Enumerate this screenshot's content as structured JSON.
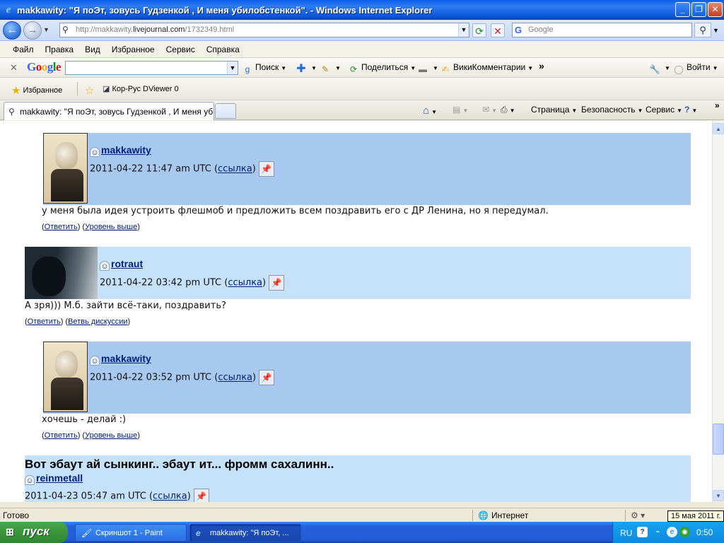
{
  "window": {
    "title": "makkawity: \"Я поЭт, зовусь Гудзенкой , И меня убилобстенкой\". - Windows Internet Explorer"
  },
  "address": {
    "url_prefix": "http://makkawity.",
    "url_domain": "livejournal.com",
    "url_path": "/1732349.html",
    "search_placeholder": "Google"
  },
  "menu": [
    "Файл",
    "Правка",
    "Вид",
    "Избранное",
    "Сервис",
    "Справка"
  ],
  "google_toolbar": {
    "search_label": "Поиск",
    "share_label": "Поделиться",
    "wiki_label": "ВикиКомментарии",
    "login_label": "Войти"
  },
  "favorites": {
    "label": "Избранное",
    "item": "Кор-Рус DViewer 0"
  },
  "tab": {
    "title": "makkawity: \"Я поЭт, зовусь Гудзенкой , И меня уби..."
  },
  "commands": {
    "page": "Страница",
    "security": "Безопасность",
    "service": "Сервис"
  },
  "comments": [
    {
      "user": "makkawity",
      "date": "2011-04-22 11:47 am UTC",
      "link": "ссылка",
      "text": "у меня была идея устроить флешмоб и предложить всем поздравить его с ДР Ленина, но я передумал.",
      "reply": "Ответить",
      "nav": "Уровень выше"
    },
    {
      "user": "rotraut",
      "date": "2011-04-22 03:42 pm UTC",
      "link": "ссылка",
      "text": "А зря))) М.б. зайти всё-таки, поздравить?",
      "reply": "Ответить",
      "nav": "Ветвь дискуссии"
    },
    {
      "user": "makkawity",
      "date": "2011-04-22 03:52 pm UTC",
      "link": "ссылка",
      "text": "хочешь - делай :)",
      "reply": "Ответить",
      "nav": "Уровень выше"
    },
    {
      "subject": "Вот эбаут ай сынкинг.. эбаут ит... фромм сахалинн..",
      "user": "reinmetall",
      "date": "2011-04-23 05:47 am UTC",
      "link": "ссылка"
    }
  ],
  "status": {
    "text": "Готово",
    "zone": "Интернет",
    "tooltip": "15 мая 2011 г."
  },
  "taskbar": {
    "start": "пуск",
    "items": [
      "Скриншот 1 - Paint",
      "makkawity: \"Я поЭт, ..."
    ],
    "lang": "RU",
    "clock": "0:50"
  }
}
